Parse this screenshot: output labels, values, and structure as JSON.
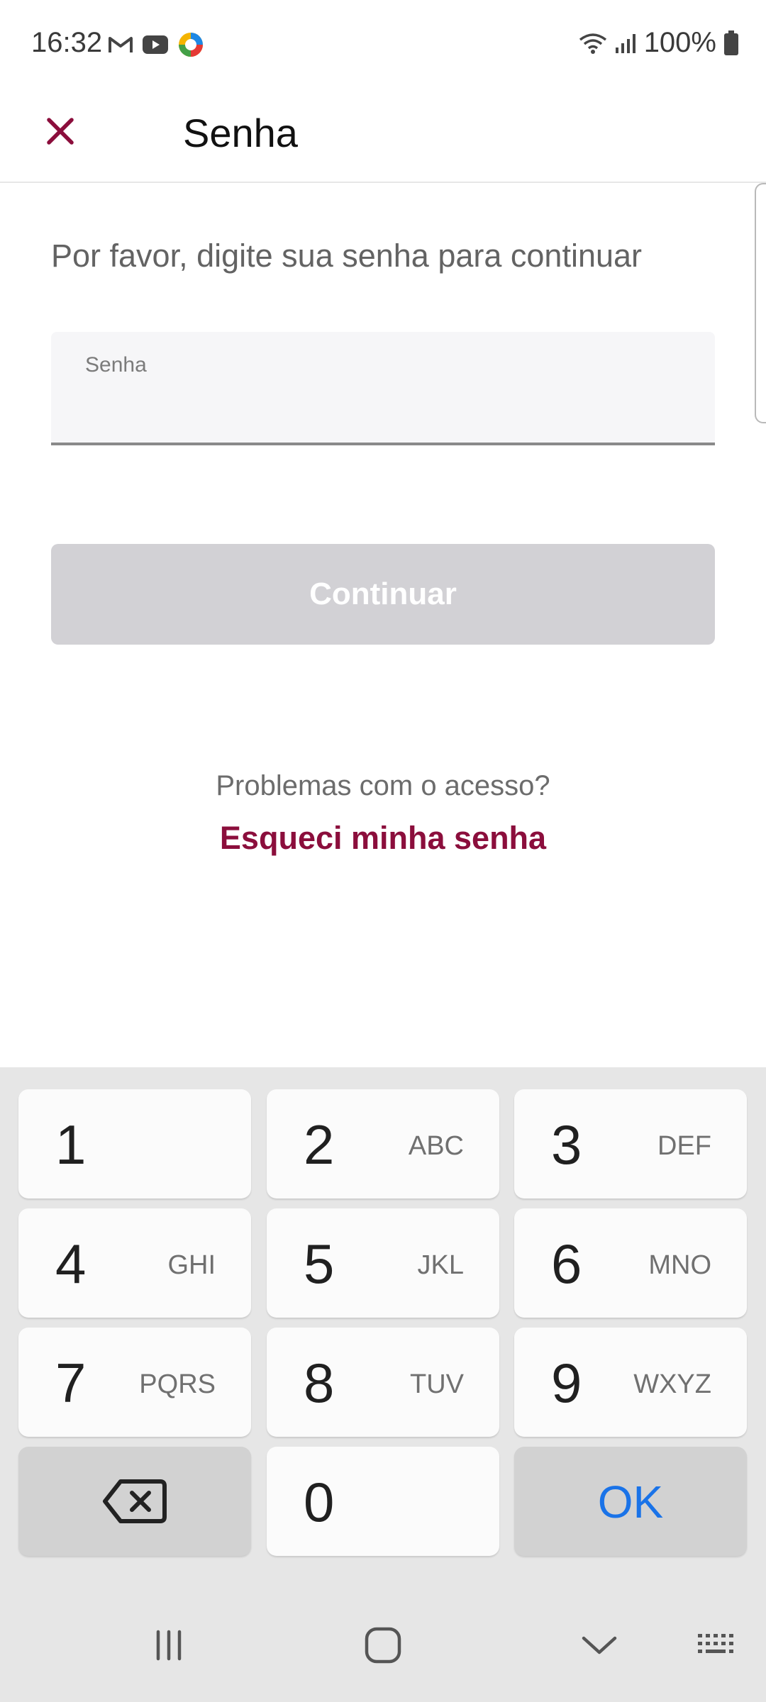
{
  "status_bar": {
    "time": "16:32",
    "battery": "100%",
    "icons": [
      "gmail-icon",
      "youtube-icon",
      "app-icon",
      "wifi-icon",
      "signal-icon",
      "battery-icon"
    ]
  },
  "header": {
    "title": "Senha",
    "close_icon": "close-icon",
    "accent_color": "#8b0e3c"
  },
  "content": {
    "prompt": "Por favor, digite sua senha para continuar",
    "password_field": {
      "label": "Senha",
      "value": ""
    },
    "continue_label": "Continuar",
    "help_text": "Problemas com o acesso?",
    "forgot_link": "Esqueci minha senha"
  },
  "keyboard": {
    "keys": [
      {
        "num": "1",
        "letters": ""
      },
      {
        "num": "2",
        "letters": "ABC"
      },
      {
        "num": "3",
        "letters": "DEF"
      },
      {
        "num": "4",
        "letters": "GHI"
      },
      {
        "num": "5",
        "letters": "JKL"
      },
      {
        "num": "6",
        "letters": "MNO"
      },
      {
        "num": "7",
        "letters": "PQRS"
      },
      {
        "num": "8",
        "letters": "TUV"
      },
      {
        "num": "9",
        "letters": "WXYZ"
      },
      {
        "num": "0",
        "letters": ""
      }
    ],
    "backspace_icon": "backspace-icon",
    "ok_label": "OK",
    "ok_color": "#1a73e8"
  },
  "nav_bar": {
    "icons": [
      "recents-icon",
      "home-icon",
      "back-down-icon",
      "keyboard-switch-icon"
    ]
  }
}
